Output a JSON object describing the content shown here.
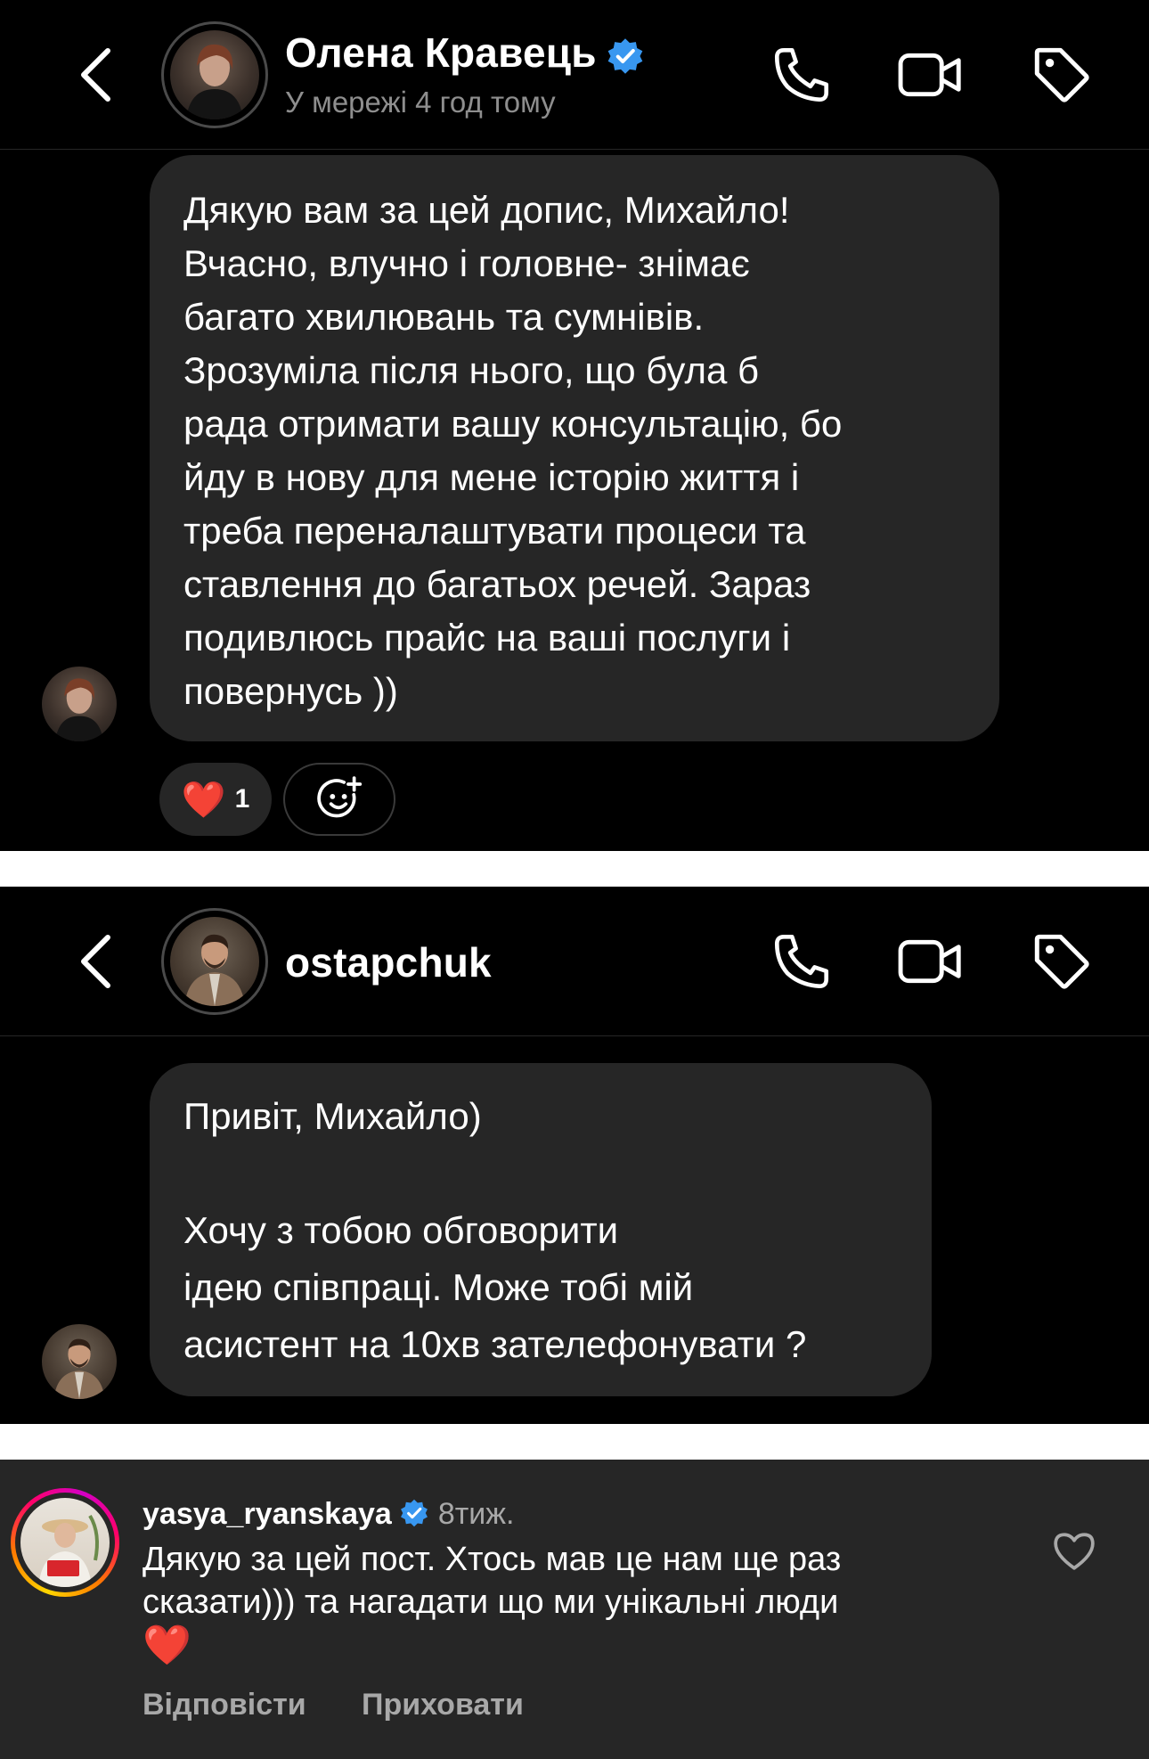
{
  "conversation1": {
    "header": {
      "name": "Олена Кравець",
      "status": "У мережі 4 год тому",
      "verified": true
    },
    "message": "Дякую вам за цей допис, Михайло!\nВчасно, влучно і головне- знімає\nбагато хвилювань та сумнівів.\nЗрозуміла після нього, що була б\nрада отримати вашу консультацію, бо\nйду в нову для мене історію життя і\nтреба переналаштувати процеси та\nставлення до багатьох речей. Зараз\nподивлюсь прайс на ваші послуги і\nповернусь ))",
    "reactions": [
      {
        "emoji": "❤️",
        "count": "1"
      }
    ]
  },
  "conversation2": {
    "header": {
      "name": "ostapchuk"
    },
    "message": "Привіт, Михайло)\n\nХочу з тобою обговорити\nідею співпраці. Може тобі мій\nасистент на 10хв зателефонувати ?"
  },
  "comment": {
    "username": "yasya_ryanskaya",
    "verified": true,
    "time": "8тиж.",
    "text": "Дякую за цей пост. Хтось мав це нам ще раз сказати))) та нагадати що ми унікальні люди",
    "emoji": "❤️",
    "actions": {
      "reply": "Відповісти",
      "hide": "Приховати"
    }
  },
  "icons": {
    "back": "chevron-left-icon",
    "call": "phone-icon",
    "video": "video-camera-icon",
    "tag": "tag-icon",
    "verified": "verified-badge-icon",
    "add_reaction": "add-emoji-icon",
    "like": "heart-outline-icon"
  },
  "colors": {
    "background": "#000000",
    "bubble": "#262626",
    "secondary_text": "#8e8e8e",
    "verified_blue": "#3897f0",
    "divider": "#ffffff"
  }
}
